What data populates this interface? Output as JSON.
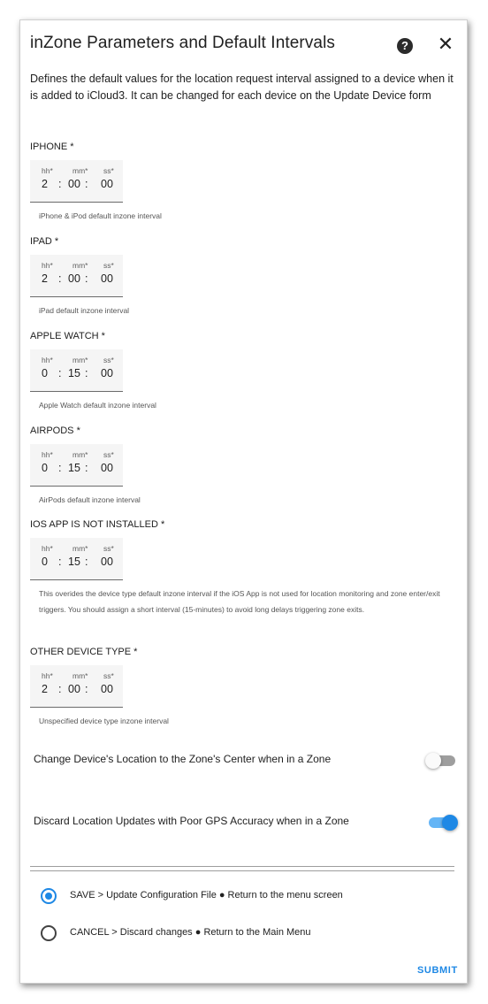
{
  "dialog": {
    "title": "inZone Parameters and Default Intervals",
    "help_icon": "help-circle-icon",
    "close_icon": "close-icon",
    "description": "Defines the default values for the location request interval assigned to a device when it is added to iCloud3. It can be changed for each device on the Update Device form"
  },
  "duration_subs": {
    "hh": "hh*",
    "mm": "mm*",
    "ss": "ss*"
  },
  "fields": [
    {
      "label": "IPHONE *",
      "hh": "2",
      "mm": "00",
      "ss": "00",
      "helper": "iPhone & iPod default inzone interval"
    },
    {
      "label": "IPAD *",
      "hh": "2",
      "mm": "00",
      "ss": "00",
      "helper": "iPad default inzone interval"
    },
    {
      "label": "APPLE WATCH *",
      "hh": "0",
      "mm": "15",
      "ss": "00",
      "helper": "Apple Watch default inzone interval"
    },
    {
      "label": "AIRPODS *",
      "hh": "0",
      "mm": "15",
      "ss": "00",
      "helper": "AirPods default inzone interval"
    },
    {
      "label": "IOS APP IS NOT INSTALLED *",
      "hh": "0",
      "mm": "15",
      "ss": "00",
      "helper": "This overides the device type default inzone interval if the iOS App is not used for location monitoring and zone enter/exit triggers. You should assign a short interval (15-minutes) to avoid long delays triggering zone exits."
    },
    {
      "label": "OTHER DEVICE TYPE *",
      "hh": "2",
      "mm": "00",
      "ss": "00",
      "helper": "Unspecified device type inzone interval"
    }
  ],
  "toggles": [
    {
      "label": "Change Device's Location to the Zone's Center when in a Zone",
      "on": false
    },
    {
      "label": "Discard Location Updates with Poor GPS Accuracy when in a Zone",
      "on": true
    }
  ],
  "actions": [
    {
      "label": "SAVE > Update Configuration File ● Return to the menu screen",
      "selected": true
    },
    {
      "label": "CANCEL > Discard changes ● Return to the Main Menu",
      "selected": false
    }
  ],
  "submit_label": "SUBMIT",
  "colors": {
    "accent": "#1e88e5",
    "toggle_on_track": "#64b5f6",
    "toggle_off_track": "#9e9e9e"
  }
}
